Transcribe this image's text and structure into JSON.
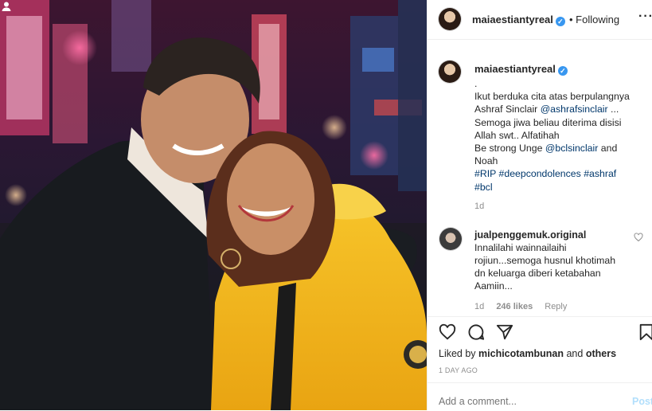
{
  "header": {
    "username": "maiaestiantyreal",
    "follow_status": "• Following",
    "more_label": "···"
  },
  "caption": {
    "username": "maiaestiantyreal",
    "lines": [
      ".",
      "Ikut berduka cita atas berpulangnya",
      "Ashraf Sinclair ",
      "@ashrafsinclair",
      " ...",
      "Semoga jiwa beliau diterima disisi",
      "Allah swt.. Alfatihah",
      "Be strong Unge ",
      "@bclsinclair",
      " and",
      "Noah",
      "#RIP #deepcondolences #ashraf",
      "#bcl"
    ],
    "time": "1d"
  },
  "comment": {
    "username": "jualpenggemuk.original",
    "text_lines": [
      "Innalilahi wainnailaihi",
      "rojiun...semoga husnul khotimah",
      "dn keluarga diberi ketabahan",
      "Aamiin..."
    ],
    "time": "1d",
    "likes": "246 likes",
    "reply": "Reply"
  },
  "post": {
    "liked_by_prefix": "Liked by ",
    "liked_by_user": "michicotambunan",
    "liked_by_suffix": " and ",
    "liked_by_others": "others",
    "date": "1 DAY AGO",
    "comment_placeholder": "Add a comment...",
    "post_label": "Post"
  },
  "icons": {
    "like": "heart-icon",
    "comment": "comment-icon",
    "share": "share-icon",
    "save": "bookmark-icon",
    "tag": "user-tag-icon",
    "verified": "verified-badge-icon"
  },
  "colors": {
    "link": "#00376b",
    "verified": "#3897f0",
    "muted": "#8e8e8e",
    "post_disabled": "#b2dffc"
  }
}
